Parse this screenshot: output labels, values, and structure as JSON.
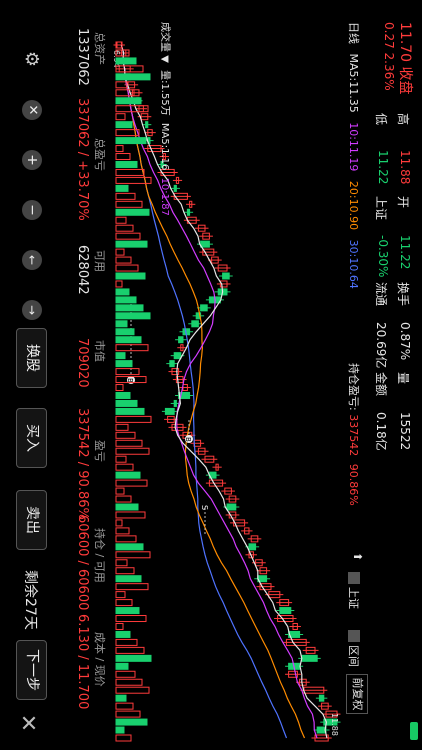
{
  "header": {
    "close_label": "收盘",
    "close_price": "11.70",
    "change": "0.27",
    "change_pct": "2.36%",
    "high_label": "高",
    "high_value": "11.88",
    "low_label": "低",
    "low_value": "11.22",
    "open_label": "开",
    "open_value": "11.22",
    "index_label": "上证",
    "index_value": "-0.30%",
    "turnover_label": "换手",
    "turnover_value": "0.87%",
    "float_label": "流通",
    "float_value": "20.69亿",
    "volume_label": "量",
    "volume_value": "15522",
    "amount_label": "金额",
    "amount_value": "0.18亿"
  },
  "ma_line": {
    "period": "日线",
    "ma5": "MA5:11.35",
    "ma10": "10:11.19",
    "ma20": "20:10.90",
    "ma30": "30:10.64"
  },
  "position": {
    "label": "持仓盈亏:",
    "value": "337542",
    "pct": "90.86%"
  },
  "toggles": {
    "index_label": "上证",
    "range_label": "区间",
    "adjust_label": "前复权"
  },
  "chart": {
    "high_label": "11.88",
    "low_label": "6.94",
    "marker_b": "B",
    "marker_s": "S"
  },
  "volume_bar": {
    "label": "成交量",
    "vol": "量:1.55万",
    "ma5": "MA5:1.16",
    "ma10": "10:1.87"
  },
  "stats": {
    "headers": [
      "总资产",
      "总盈亏",
      "可用",
      "市值",
      "盈亏",
      "持仓 / 可用",
      "成本 / 现价"
    ],
    "values": [
      "1337062",
      "337062 / +33.70%",
      "628042",
      "709020",
      "337542 / 90.86%",
      "60600 / 60600",
      "6.130 / 11.700"
    ]
  },
  "actions": {
    "switch": "换股",
    "buy": "买入",
    "sell": "卖出",
    "remaining": "剩余27天",
    "next": "下一步"
  },
  "colors": {
    "up": "#ff3b3b",
    "down": "#19d06e",
    "ma5": "#e6e6e6",
    "ma10": "#d23cff",
    "ma20": "#ff8c00",
    "ma30": "#4f73ff"
  },
  "price_series": {
    "close": [
      7.0,
      7.1,
      7.0,
      7.2,
      7.1,
      7.3,
      7.4,
      7.35,
      7.5,
      7.6,
      7.55,
      7.7,
      7.6,
      7.9,
      8.0,
      7.9,
      8.2,
      8.3,
      8.2,
      8.5,
      8.6,
      8.5,
      8.7,
      8.9,
      9.0,
      8.8,
      9.1,
      9.2,
      9.4,
      9.3,
      9.4,
      9.2,
      9.0,
      8.8,
      8.7,
      8.6,
      8.4,
      8.3,
      8.4,
      8.2,
      8.1,
      8.3,
      8.4,
      8.5,
      8.3,
      8.2,
      8.0,
      8.2,
      8.4,
      8.6,
      8.8,
      8.9,
      9.1,
      9.2,
      9.0,
      9.3,
      9.5,
      9.6,
      9.4,
      9.6,
      9.8,
      9.9,
      10.1,
      9.9,
      10.0,
      10.2,
      10.3,
      10.1,
      10.4,
      10.6,
      10.8,
      10.6,
      10.9,
      11.0,
      10.8,
      11.2,
      11.4,
      11.1,
      10.8,
      11.0,
      11.2,
      11.6,
      11.5,
      11.7,
      11.9,
      11.6,
      11.45,
      11.7
    ]
  }
}
